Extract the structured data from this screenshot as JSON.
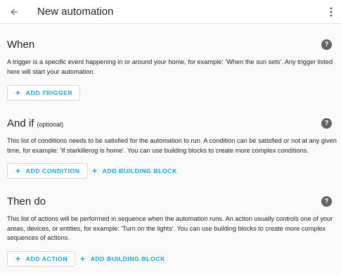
{
  "header": {
    "back_icon": "arrow-left-icon",
    "title": "New automation",
    "menu_icon": "dots-vertical-icon"
  },
  "sections": [
    {
      "title": "When",
      "optional": "",
      "help_icon": "help-circle-icon",
      "help_glyph": "?",
      "description": "A trigger is a specific event happening in or around your home, for example: 'When the sun sets'. Any trigger listed here will start your automation.",
      "buttons": [
        {
          "plus": "+",
          "label": "ADD TRIGGER"
        }
      ]
    },
    {
      "title": "And if",
      "optional": "(optional)",
      "help_icon": "help-circle-icon",
      "help_glyph": "?",
      "description": "This list of conditions needs to be satisfied for the automation to run. A condition can be satisfied or not at any given time, for example: 'If starkillerog is home'. You can use building blocks to create more complex conditions.",
      "buttons": [
        {
          "plus": "+",
          "label": "ADD CONDITION"
        },
        {
          "plus": "+",
          "label": "ADD BUILDING BLOCK"
        }
      ]
    },
    {
      "title": "Then do",
      "optional": "",
      "help_icon": "help-circle-icon",
      "help_glyph": "?",
      "description": "This list of actions will be performed in sequence when the automation runs. An action usually controls one of your areas, devices, or entities, for example: 'Turn on the lights'. You can use building blocks to create more complex sequences of actions.",
      "buttons": [
        {
          "plus": "+",
          "label": "ADD ACTION"
        },
        {
          "plus": "+",
          "label": "ADD BUILDING BLOCK"
        }
      ]
    }
  ],
  "colors": {
    "accent": "#03a9f4",
    "text": "#212121",
    "icon": "#616161",
    "background": "#fafafa"
  }
}
